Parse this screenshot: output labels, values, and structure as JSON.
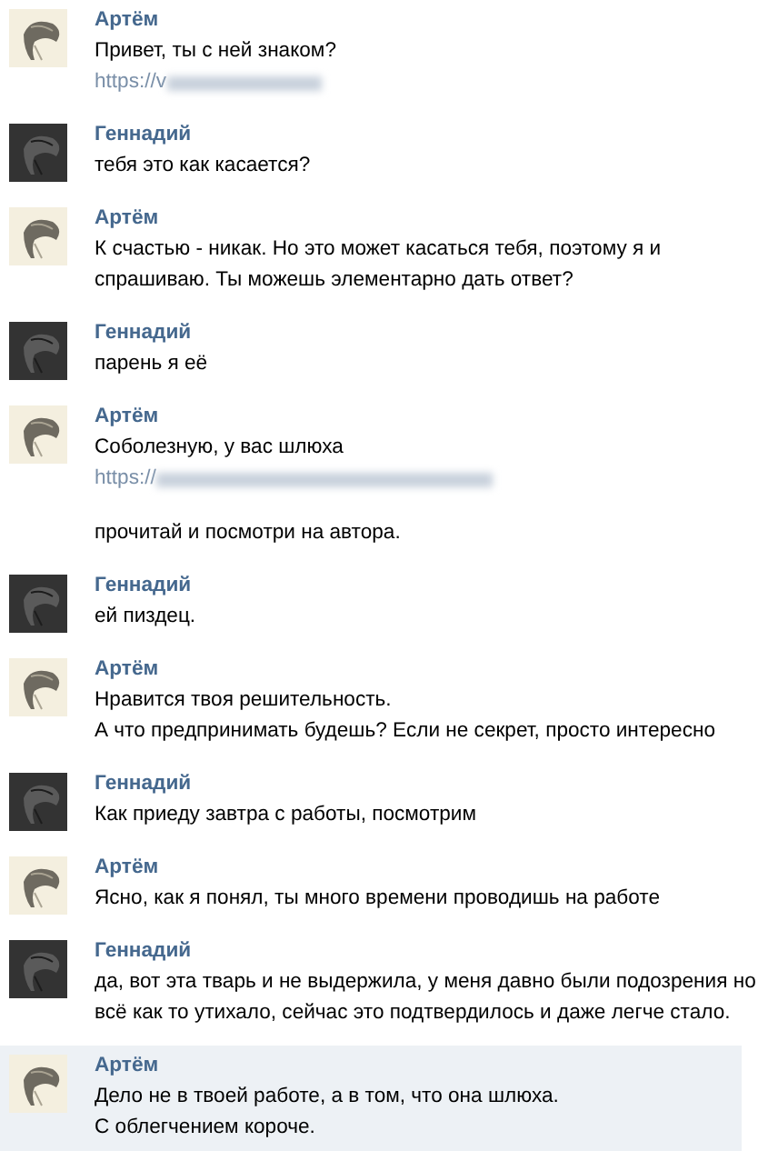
{
  "messages": [
    {
      "author": "Артём",
      "highlighted": false,
      "parts": [
        {
          "kind": "text",
          "text": "Привет, ты с ней знаком?"
        },
        {
          "kind": "link",
          "text": "https://v"
        }
      ]
    },
    {
      "author": "Геннадий",
      "highlighted": false,
      "parts": [
        {
          "kind": "text",
          "text": "тебя это как касается?"
        }
      ]
    },
    {
      "author": "Артём",
      "highlighted": false,
      "parts": [
        {
          "kind": "text",
          "text": "К счастью - никак. Но это может касаться тебя, поэтому я и"
        },
        {
          "kind": "text",
          "text": "спрашиваю. Ты можешь элементарно дать ответ?"
        }
      ]
    },
    {
      "author": "Геннадий",
      "highlighted": false,
      "parts": [
        {
          "kind": "text",
          "text": "парень я её"
        }
      ]
    },
    {
      "author": "Артём",
      "highlighted": false,
      "parts": [
        {
          "kind": "text",
          "text": "Соболезную, у вас шлюха"
        },
        {
          "kind": "link",
          "text": "https://"
        },
        {
          "kind": "spaced",
          "text": "прочитай и посмотри на автора."
        }
      ]
    },
    {
      "author": "Геннадий",
      "highlighted": false,
      "parts": [
        {
          "kind": "text",
          "text": "ей пиздец."
        }
      ]
    },
    {
      "author": "Артём",
      "highlighted": false,
      "parts": [
        {
          "kind": "text",
          "text": "Нравится твоя решительность."
        },
        {
          "kind": "text",
          "text": "А что предпринимать будешь? Если не секрет, просто интересно"
        }
      ]
    },
    {
      "author": "Геннадий",
      "highlighted": false,
      "parts": [
        {
          "kind": "text",
          "text": "Как приеду завтра с работы, посмотрим"
        }
      ]
    },
    {
      "author": "Артём",
      "highlighted": false,
      "parts": [
        {
          "kind": "text",
          "text": "Ясно, как я понял, ты много времени проводишь на работе"
        }
      ]
    },
    {
      "author": "Геннадий",
      "highlighted": false,
      "parts": [
        {
          "kind": "text",
          "text": "да, вот эта тварь и не выдержила, у меня давно были подозрения но"
        },
        {
          "kind": "text",
          "text": "всё как то утихало, сейчас это подтвердилось и даже легче стало."
        }
      ]
    },
    {
      "author": "Артём",
      "highlighted": true,
      "parts": [
        {
          "kind": "text",
          "text": "Дело не в твоей работе, а в том, что она шлюха."
        },
        {
          "kind": "text",
          "text": "С облегчением короче."
        }
      ]
    }
  ]
}
